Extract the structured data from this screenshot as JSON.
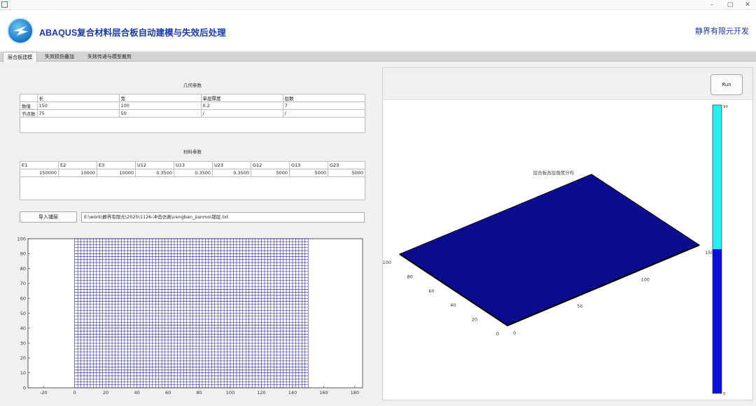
{
  "app": {
    "title": "ABAQUS复合材料层合板自动建模与失效后处理",
    "developer": "静界有限元开发"
  },
  "window_controls": {
    "minimize": "–",
    "maximize": "▢",
    "close": "✕"
  },
  "tabs": [
    {
      "label": "层合板建模",
      "active": true
    },
    {
      "label": "失效损伤叠加",
      "active": false
    },
    {
      "label": "失效传递与模型裁剪",
      "active": false
    }
  ],
  "geometry": {
    "title": "几何参数",
    "columns": [
      "",
      "长",
      "宽",
      "单层厚度",
      "层数"
    ],
    "rows": [
      [
        "数值",
        "150",
        "100",
        "0.2",
        "7"
      ],
      [
        "节点数",
        "75",
        "50",
        "/",
        "/"
      ]
    ]
  },
  "material": {
    "title": "材料参数",
    "columns": [
      "E1",
      "E2",
      "E3",
      "U12",
      "U13",
      "U23",
      "G12",
      "G13",
      "G23"
    ],
    "values": [
      "150000",
      "10000",
      "10000",
      "0.3500",
      "0.3500",
      "0.3500",
      "5000",
      "5000",
      "5000"
    ]
  },
  "import": {
    "button_label": "导入铺层",
    "path": "E:\\work\\静界有限元\\2025\\1126-冲击仿真\\cengban_jianmo\\铺层.txt"
  },
  "run_button": "Run",
  "plot_title": "层合板各层角度分布",
  "chart_data": [
    {
      "type": "scatter",
      "title": "",
      "xlabel": "",
      "ylabel": "",
      "xlim": [
        -30,
        185
      ],
      "ylim": [
        0,
        100
      ],
      "xticks": [
        "-20",
        "0",
        "20",
        "40",
        "60",
        "80",
        "100",
        "120",
        "140",
        "160",
        "180"
      ],
      "yticks": [
        "0",
        "10",
        "20",
        "30",
        "40",
        "50",
        "60",
        "70",
        "80",
        "90",
        "100"
      ],
      "mesh": {
        "x_range": [
          0,
          150
        ],
        "y_range": [
          0,
          100
        ],
        "x_nodes": 75,
        "y_nodes": 50
      },
      "color": "#1a1a8c"
    },
    {
      "type": "surface",
      "title": "层合板各层角度分布",
      "x_ticks": [
        "0",
        "50",
        "100",
        "150"
      ],
      "y_ticks": [
        "0",
        "20",
        "40",
        "60",
        "80",
        "100"
      ],
      "surface_value": 0,
      "colorbar": {
        "min": "0",
        "max": "90",
        "colors": [
          "#0b0fd2",
          "#26f0ef"
        ]
      },
      "color": "#0d0d98"
    }
  ]
}
